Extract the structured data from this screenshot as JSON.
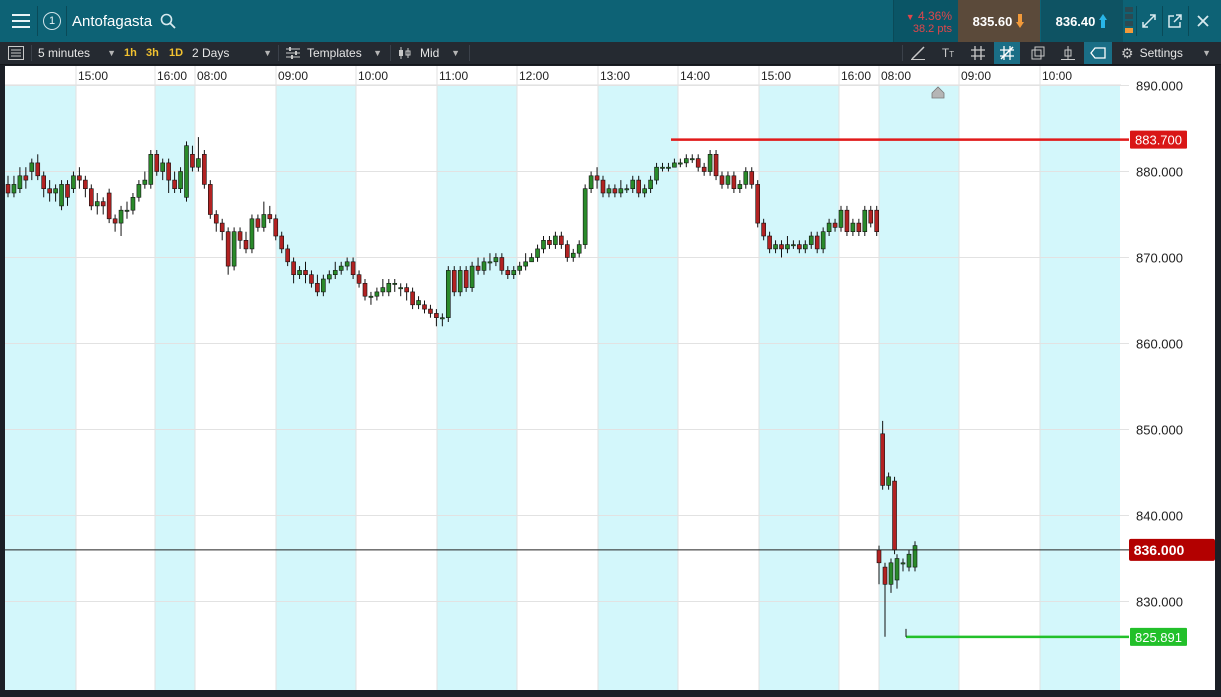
{
  "header": {
    "menu_icon": "hamburger-menu-icon",
    "layout_badge": "1",
    "instrument": "Antofagasta",
    "change_pct": "4.36%",
    "change_pts": "38.2 pts",
    "sell_price": "835.60",
    "buy_price": "836.40",
    "colors": {
      "header_bg": "#0d6275",
      "sell_bg": "#5b4a3a",
      "buy_bg": "#0e5363",
      "down": "#e0464a",
      "arrow_orange": "#f29a3a",
      "arrow_blue": "#29b6e8"
    }
  },
  "toolbar": {
    "interval": "5 minutes",
    "quick_intervals": [
      "1h",
      "3h",
      "1D"
    ],
    "range": "2 Days",
    "templates": "Templates",
    "price_type": "Mid",
    "settings": "Settings"
  },
  "chart_data": {
    "type": "candlestick",
    "time_labels": [
      "15:00",
      "16:00",
      "08:00",
      "09:00",
      "10:00",
      "11:00",
      "12:00",
      "13:00",
      "14:00",
      "15:00",
      "16:00",
      "08:00",
      "09:00",
      "10:00"
    ],
    "y_ticks": [
      830,
      840,
      850,
      860,
      870,
      880,
      890
    ],
    "ylim": [
      821.5,
      890.5
    ],
    "current_price": "836.000",
    "high_line": "883.700",
    "low_line": "825.891",
    "grid": true,
    "candles": [
      [
        878.5,
        877.5,
        879.5,
        877.0
      ],
      [
        877.5,
        878.5,
        879.5,
        877.0
      ],
      [
        878.0,
        879.5,
        880.5,
        877.5
      ],
      [
        879.5,
        879.0,
        880.5,
        878.0
      ],
      [
        880.0,
        881.0,
        881.5,
        879.0
      ],
      [
        881.0,
        879.5,
        882.0,
        879.0
      ],
      [
        879.5,
        878.0,
        880.0,
        877.0
      ],
      [
        878.0,
        877.5,
        879.0,
        876.5
      ],
      [
        877.5,
        878.0,
        878.5,
        876.5
      ],
      [
        876.0,
        878.5,
        879.0,
        875.5
      ],
      [
        878.5,
        877.0,
        879.0,
        876.0
      ],
      [
        878.0,
        879.5,
        880.0,
        877.5
      ],
      [
        879.5,
        879.0,
        880.5,
        878.0
      ],
      [
        879.0,
        878.0,
        879.5,
        877.0
      ],
      [
        878.0,
        876.0,
        878.5,
        875.5
      ],
      [
        876.0,
        876.5,
        877.5,
        875.0
      ],
      [
        876.5,
        876.0,
        877.0,
        875.0
      ],
      [
        877.5,
        874.5,
        878.0,
        874.0
      ],
      [
        874.5,
        874.0,
        875.0,
        873.0
      ],
      [
        874.0,
        875.5,
        876.0,
        872.5
      ],
      [
        875.5,
        875.5,
        876.5,
        874.5
      ],
      [
        875.5,
        877.0,
        877.5,
        875.0
      ],
      [
        877.0,
        878.5,
        879.0,
        876.5
      ],
      [
        878.5,
        879.0,
        880.0,
        878.0
      ],
      [
        878.5,
        882.0,
        882.5,
        878.0
      ],
      [
        882.0,
        880.0,
        882.5,
        879.5
      ],
      [
        880.0,
        881.0,
        881.5,
        879.0
      ],
      [
        881.0,
        879.0,
        881.5,
        877.5
      ],
      [
        879.0,
        878.0,
        880.0,
        877.5
      ],
      [
        878.0,
        880.0,
        880.5,
        877.5
      ],
      [
        877.0,
        883.0,
        883.5,
        876.5
      ],
      [
        882.0,
        880.5,
        883.0,
        880.0
      ],
      [
        880.5,
        881.5,
        884.0,
        880.0
      ],
      [
        882.0,
        878.5,
        882.5,
        878.0
      ],
      [
        878.5,
        875.0,
        879.0,
        874.5
      ],
      [
        875.0,
        874.0,
        875.5,
        873.0
      ],
      [
        874.0,
        873.0,
        874.5,
        872.0
      ],
      [
        873.0,
        869.0,
        873.5,
        868.0
      ],
      [
        869.0,
        873.0,
        873.5,
        868.5
      ],
      [
        873.0,
        872.0,
        873.5,
        871.0
      ],
      [
        872.0,
        871.0,
        873.0,
        870.5
      ],
      [
        871.0,
        874.5,
        875.0,
        870.5
      ],
      [
        874.5,
        873.5,
        875.0,
        873.0
      ],
      [
        873.5,
        875.0,
        876.5,
        873.0
      ],
      [
        875.0,
        874.5,
        876.0,
        874.0
      ],
      [
        874.5,
        872.5,
        875.0,
        872.0
      ],
      [
        872.5,
        871.0,
        873.0,
        870.5
      ],
      [
        871.0,
        869.5,
        871.5,
        869.0
      ],
      [
        869.5,
        868.0,
        870.0,
        867.0
      ],
      [
        868.0,
        868.5,
        869.0,
        867.5
      ],
      [
        868.5,
        868.0,
        869.5,
        867.0
      ],
      [
        868.0,
        867.0,
        868.5,
        866.5
      ],
      [
        867.0,
        866.0,
        868.0,
        865.5
      ],
      [
        866.0,
        867.5,
        868.0,
        865.5
      ],
      [
        867.5,
        868.0,
        868.5,
        867.0
      ],
      [
        868.0,
        868.5,
        869.5,
        867.5
      ],
      [
        868.5,
        869.0,
        869.5,
        868.0
      ],
      [
        869.0,
        869.5,
        870.0,
        868.5
      ],
      [
        869.5,
        868.0,
        870.0,
        867.5
      ],
      [
        868.0,
        867.0,
        868.5,
        866.5
      ],
      [
        867.0,
        865.5,
        867.5,
        865.0
      ],
      [
        865.5,
        865.5,
        866.0,
        864.5
      ],
      [
        865.5,
        866.0,
        866.5,
        865.0
      ],
      [
        866.0,
        866.5,
        867.5,
        865.5
      ],
      [
        866.0,
        867.0,
        867.5,
        865.5
      ],
      [
        867.0,
        867.0,
        867.5,
        866.0
      ],
      [
        866.5,
        866.5,
        867.0,
        865.5
      ],
      [
        866.5,
        866.0,
        867.0,
        865.0
      ],
      [
        866.0,
        864.5,
        866.5,
        864.0
      ],
      [
        864.5,
        865.0,
        865.5,
        864.0
      ],
      [
        864.5,
        864.0,
        865.0,
        863.5
      ],
      [
        864.0,
        863.5,
        864.5,
        863.0
      ],
      [
        863.5,
        863.0,
        864.0,
        862.0
      ],
      [
        863.0,
        863.0,
        863.5,
        862.0
      ],
      [
        863.0,
        868.5,
        869.0,
        862.5
      ],
      [
        868.5,
        866.0,
        869.0,
        865.5
      ],
      [
        866.0,
        868.5,
        869.0,
        865.5
      ],
      [
        868.5,
        866.5,
        869.0,
        866.0
      ],
      [
        866.5,
        869.0,
        869.5,
        866.0
      ],
      [
        869.0,
        868.5,
        870.0,
        868.0
      ],
      [
        868.5,
        869.5,
        870.0,
        868.0
      ],
      [
        869.5,
        869.5,
        870.5,
        868.5
      ],
      [
        869.5,
        870.0,
        870.5,
        869.0
      ],
      [
        870.0,
        868.5,
        870.5,
        868.0
      ],
      [
        868.5,
        868.0,
        869.0,
        867.5
      ],
      [
        868.0,
        868.5,
        869.0,
        867.5
      ],
      [
        868.5,
        869.0,
        869.5,
        868.0
      ],
      [
        869.0,
        869.5,
        870.5,
        868.5
      ],
      [
        869.5,
        870.0,
        870.5,
        869.5
      ],
      [
        870.0,
        871.0,
        871.5,
        869.5
      ],
      [
        871.0,
        872.0,
        872.5,
        870.5
      ],
      [
        872.0,
        871.5,
        872.5,
        871.0
      ],
      [
        871.5,
        872.5,
        873.0,
        871.0
      ],
      [
        872.5,
        871.5,
        873.0,
        871.0
      ],
      [
        871.5,
        870.0,
        872.0,
        869.5
      ],
      [
        870.0,
        870.5,
        871.0,
        869.5
      ],
      [
        870.5,
        871.5,
        872.0,
        870.0
      ],
      [
        871.5,
        878.0,
        878.5,
        871.0
      ],
      [
        878.0,
        879.5,
        880.0,
        877.5
      ],
      [
        879.5,
        879.0,
        880.5,
        878.0
      ],
      [
        879.0,
        877.5,
        879.5,
        877.0
      ],
      [
        877.5,
        878.0,
        878.5,
        877.0
      ],
      [
        878.0,
        877.5,
        878.5,
        877.0
      ],
      [
        877.5,
        878.0,
        879.0,
        877.0
      ],
      [
        878.0,
        878.0,
        878.5,
        877.5
      ],
      [
        878.0,
        879.0,
        879.5,
        877.5
      ],
      [
        879.0,
        877.5,
        879.5,
        877.0
      ],
      [
        877.5,
        878.0,
        878.5,
        877.0
      ],
      [
        878.0,
        879.0,
        879.5,
        877.5
      ],
      [
        879.0,
        880.5,
        881.0,
        878.5
      ],
      [
        880.5,
        880.5,
        881.0,
        880.0
      ],
      [
        880.5,
        880.5,
        881.0,
        880.0
      ],
      [
        880.5,
        881.0,
        881.5,
        880.5
      ],
      [
        881.0,
        881.0,
        881.5,
        880.5
      ],
      [
        881.0,
        881.5,
        882.0,
        880.5
      ],
      [
        881.5,
        881.5,
        882.0,
        881.0
      ],
      [
        881.5,
        880.5,
        882.0,
        880.0
      ],
      [
        880.5,
        880.0,
        881.0,
        879.5
      ],
      [
        880.0,
        882.0,
        882.5,
        879.5
      ],
      [
        882.0,
        879.5,
        882.5,
        879.0
      ],
      [
        879.5,
        878.5,
        880.0,
        878.0
      ],
      [
        878.5,
        879.5,
        880.0,
        878.0
      ],
      [
        879.5,
        878.0,
        880.0,
        877.5
      ],
      [
        878.0,
        878.5,
        879.0,
        877.5
      ],
      [
        878.5,
        880.0,
        880.5,
        878.0
      ],
      [
        880.0,
        878.5,
        880.5,
        878.0
      ],
      [
        878.5,
        874.0,
        879.0,
        873.5
      ],
      [
        874.0,
        872.5,
        874.5,
        872.0
      ],
      [
        872.5,
        871.0,
        873.0,
        870.5
      ],
      [
        871.0,
        871.5,
        872.0,
        870.5
      ],
      [
        871.5,
        871.0,
        872.0,
        870.0
      ],
      [
        871.0,
        871.5,
        872.5,
        870.5
      ],
      [
        871.5,
        871.5,
        872.0,
        871.0
      ],
      [
        871.5,
        871.0,
        872.0,
        870.5
      ],
      [
        871.0,
        871.5,
        872.0,
        870.5
      ],
      [
        871.5,
        872.5,
        873.0,
        871.0
      ],
      [
        872.5,
        871.0,
        873.0,
        870.5
      ],
      [
        871.0,
        873.0,
        873.5,
        870.5
      ],
      [
        873.0,
        874.0,
        874.5,
        872.5
      ],
      [
        874.0,
        873.5,
        874.5,
        873.0
      ],
      [
        873.5,
        875.5,
        876.0,
        873.0
      ],
      [
        875.5,
        873.0,
        876.0,
        872.5
      ],
      [
        873.0,
        874.0,
        874.5,
        872.5
      ],
      [
        874.0,
        873.0,
        874.5,
        872.5
      ],
      [
        873.0,
        875.5,
        876.0,
        872.5
      ],
      [
        875.5,
        874.0,
        876.0,
        873.5
      ],
      [
        875.5,
        873.0,
        876.0,
        872.5
      ],
      [
        849.5,
        843.5,
        851.0,
        843.0
      ],
      [
        843.5,
        844.5,
        845.0,
        843.0
      ],
      [
        844.0,
        836.0,
        844.5,
        835.5
      ],
      [
        836.0,
        834.5,
        836.5,
        832.0
      ],
      [
        834.0,
        832.0,
        834.5,
        825.9
      ],
      [
        832.0,
        834.5,
        835.0,
        831.0
      ],
      [
        832.5,
        835.0,
        835.5,
        831.5
      ],
      [
        834.5,
        834.5,
        835.0,
        833.5
      ],
      [
        834.0,
        835.5,
        836.0,
        833.5
      ],
      [
        834.0,
        836.5,
        837.0,
        833.5
      ]
    ]
  }
}
